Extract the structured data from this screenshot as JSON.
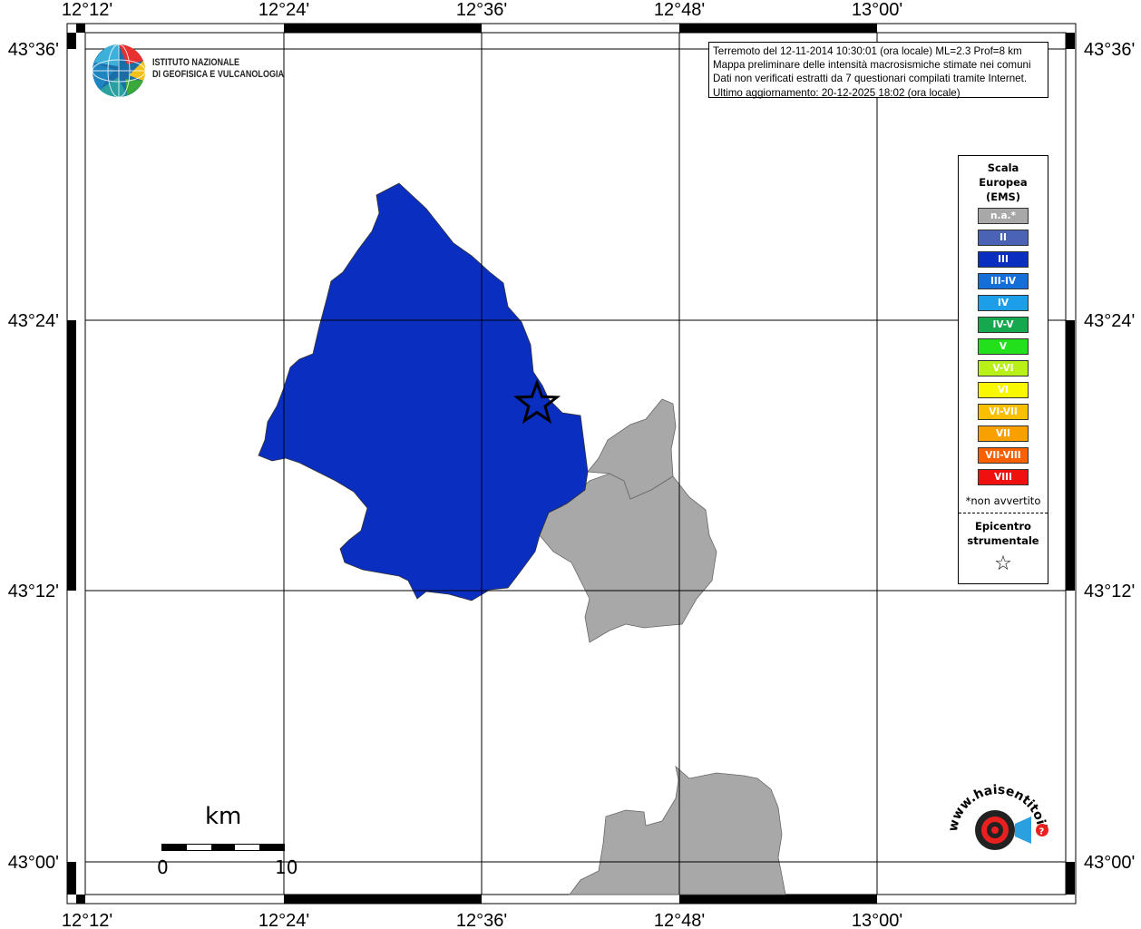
{
  "coordinates": {
    "top_lon": [
      "12°12'",
      "12°24'",
      "12°36'",
      "12°48'",
      "13°00'"
    ],
    "bottom_lon": [
      "12°12'",
      "12°24'",
      "12°36'",
      "12°48'",
      "13°00'"
    ],
    "left_lat": [
      "43°36'",
      "43°24'",
      "43°12'",
      "43°00'"
    ],
    "right_lat": [
      "43°36'",
      "43°24'",
      "43°12'",
      "43°00'"
    ]
  },
  "info": {
    "line1": "Terremoto del 12-11-2014 10:30:01 (ora locale) ML=2.3 Prof=8 km",
    "line2": "Mappa preliminare delle intensità macrosismiche stimate nei comuni",
    "line3": "Dati non verificati estratti da 7 questionari compilati tramite Internet.",
    "line4": "Ultimo aggiornamento: 20-12-2025 18:02 (ora locale)"
  },
  "ingv_logo": {
    "line1": "ISTITUTO NAZIONALE",
    "line2": "DI GEOFISICA E VULCANOLOGIA"
  },
  "legend": {
    "title1": "Scala",
    "title2": "Europea",
    "title3": "(EMS)",
    "items": [
      {
        "label": "n.a.*",
        "color": "#a8a8a8"
      },
      {
        "label": "II",
        "color": "#4a63b5"
      },
      {
        "label": "III",
        "color": "#0a2fc0"
      },
      {
        "label": "III-IV",
        "color": "#1470d8"
      },
      {
        "label": "IV",
        "color": "#1c9ee8"
      },
      {
        "label": "IV-V",
        "color": "#16a84e"
      },
      {
        "label": "V",
        "color": "#22e01c"
      },
      {
        "label": "V-VI",
        "color": "#b8f018"
      },
      {
        "label": "VI",
        "color": "#f8f800"
      },
      {
        "label": "VI-VII",
        "color": "#f8c000"
      },
      {
        "label": "VII",
        "color": "#f8a000"
      },
      {
        "label": "VII-VIII",
        "color": "#f86000"
      },
      {
        "label": "VIII",
        "color": "#f01010"
      }
    ],
    "note": "*non avvertito",
    "epicenter1": "Epicentro",
    "epicenter2": "strumentale",
    "epicenter_symbol": "☆"
  },
  "scale": {
    "unit": "km",
    "start": "0",
    "end": "10"
  },
  "regions": [
    {
      "name": "municipality-main",
      "intensity": "III",
      "color": "#0a2fc0"
    },
    {
      "name": "municipality-east-north",
      "intensity": "n.a.*",
      "color": "#a8a8a8"
    },
    {
      "name": "municipality-east-south",
      "intensity": "n.a.*",
      "color": "#a8a8a8"
    },
    {
      "name": "municipality-bottom",
      "intensity": "n.a.*",
      "color": "#a8a8a8"
    }
  ],
  "hsi_logo": {
    "text": "www.haisentitoilterremoto.it",
    "badge": "?"
  }
}
